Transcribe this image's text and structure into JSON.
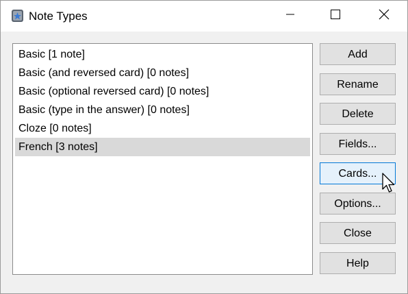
{
  "window": {
    "title": "Note Types"
  },
  "icons": {
    "app": "anki-app-icon",
    "minimize": "minimize-icon",
    "maximize": "maximize-icon",
    "close": "close-icon",
    "cursor": "mouse-pointer-icon"
  },
  "colors": {
    "selection": "#d9d9d9",
    "focused_border": "#0078d7",
    "focused_background": "#e5f1fb",
    "button_background": "#e1e1e1"
  },
  "note_types": [
    {
      "label": "Basic [1 note]",
      "selected": false
    },
    {
      "label": "Basic (and reversed card) [0 notes]",
      "selected": false
    },
    {
      "label": "Basic (optional reversed card) [0 notes]",
      "selected": false
    },
    {
      "label": "Basic (type in the answer) [0 notes]",
      "selected": false
    },
    {
      "label": "Cloze [0 notes]",
      "selected": false
    },
    {
      "label": "French [3 notes]",
      "selected": true
    }
  ],
  "buttons": {
    "add": "Add",
    "rename": "Rename",
    "delete": "Delete",
    "fields": "Fields...",
    "cards": "Cards...",
    "options": "Options...",
    "close": "Close",
    "help": "Help"
  },
  "focused_button": "cards"
}
